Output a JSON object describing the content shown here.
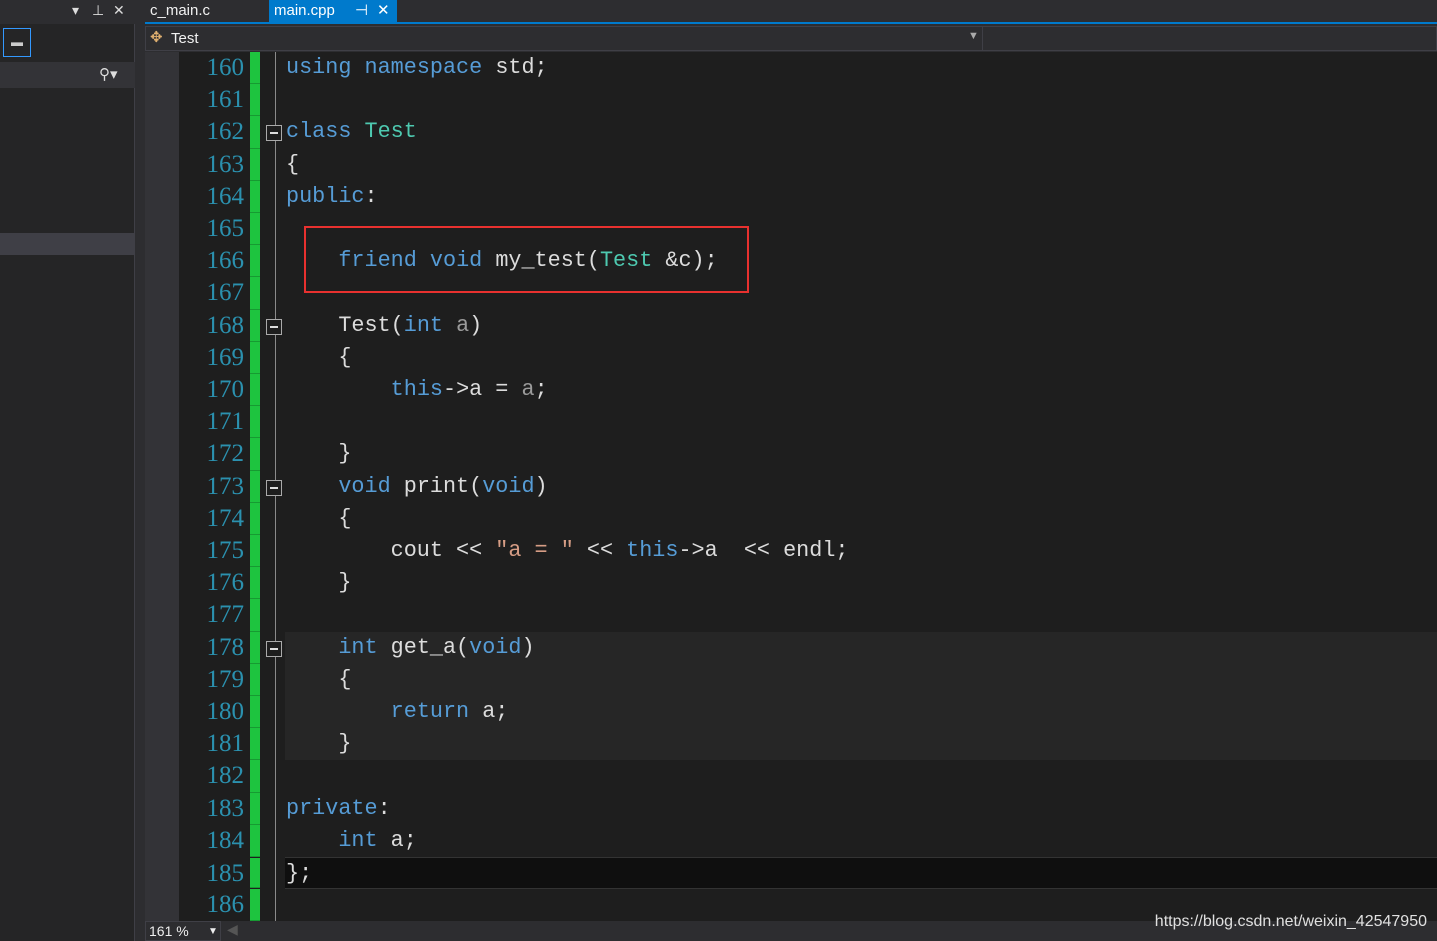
{
  "tabs": [
    {
      "label": "c_main.c",
      "active": false
    },
    {
      "label": "main.cpp",
      "active": true
    }
  ],
  "nav": {
    "scope": "Test"
  },
  "status": {
    "zoom": "161 %"
  },
  "watermark": "https://blog.csdn.net/weixin_42547950",
  "colors": {
    "keyword": "#569cd6",
    "type": "#4ec9b0",
    "text": "#dcdcdc",
    "param": "#9b9b9b",
    "string": "#d69d85",
    "linenum": "#2b91af",
    "accent": "#007acc",
    "highlight_box": "#e8312f"
  },
  "code": [
    {
      "n": "160",
      "t": [
        [
          "k",
          "using"
        ],
        [
          "p",
          " "
        ],
        [
          "k",
          "namespace"
        ],
        [
          "p",
          " std;"
        ]
      ]
    },
    {
      "n": "161",
      "t": []
    },
    {
      "n": "162",
      "fold": true,
      "t": [
        [
          "k",
          "class"
        ],
        [
          "p",
          " "
        ],
        [
          "y",
          "Test"
        ]
      ]
    },
    {
      "n": "163",
      "t": [
        [
          "p",
          "{"
        ]
      ]
    },
    {
      "n": "164",
      "t": [
        [
          "k",
          "public"
        ],
        [
          "p",
          ":"
        ]
      ]
    },
    {
      "n": "165",
      "t": []
    },
    {
      "n": "166",
      "t": [
        [
          "p",
          "    "
        ],
        [
          "k",
          "friend"
        ],
        [
          "p",
          " "
        ],
        [
          "k",
          "void"
        ],
        [
          "p",
          " my_test("
        ],
        [
          "y",
          "Test"
        ],
        [
          "p",
          " &c);"
        ]
      ]
    },
    {
      "n": "167",
      "t": []
    },
    {
      "n": "168",
      "fold": true,
      "t": [
        [
          "p",
          "    Test("
        ],
        [
          "k",
          "int"
        ],
        [
          "p",
          " "
        ],
        [
          "a",
          "a"
        ],
        [
          "p",
          ")"
        ]
      ]
    },
    {
      "n": "169",
      "t": [
        [
          "p",
          "    {"
        ]
      ]
    },
    {
      "n": "170",
      "t": [
        [
          "p",
          "        "
        ],
        [
          "k",
          "this"
        ],
        [
          "p",
          "->a = "
        ],
        [
          "a",
          "a"
        ],
        [
          "p",
          ";"
        ]
      ]
    },
    {
      "n": "171",
      "t": []
    },
    {
      "n": "172",
      "t": [
        [
          "p",
          "    }"
        ]
      ]
    },
    {
      "n": "173",
      "fold": true,
      "t": [
        [
          "p",
          "    "
        ],
        [
          "k",
          "void"
        ],
        [
          "p",
          " print("
        ],
        [
          "k",
          "void"
        ],
        [
          "p",
          ")"
        ]
      ]
    },
    {
      "n": "174",
      "t": [
        [
          "p",
          "    {"
        ]
      ]
    },
    {
      "n": "175",
      "t": [
        [
          "p",
          "        cout << "
        ],
        [
          "s",
          "\"a = \""
        ],
        [
          "p",
          " << "
        ],
        [
          "k",
          "this"
        ],
        [
          "p",
          "->a  << endl;"
        ]
      ]
    },
    {
      "n": "176",
      "t": [
        [
          "p",
          "    }"
        ]
      ]
    },
    {
      "n": "177",
      "t": []
    },
    {
      "n": "178",
      "fold": true,
      "t": [
        [
          "p",
          "    "
        ],
        [
          "k",
          "int"
        ],
        [
          "p",
          " get_a("
        ],
        [
          "k",
          "void"
        ],
        [
          "p",
          ")"
        ]
      ]
    },
    {
      "n": "179",
      "t": [
        [
          "p",
          "    {"
        ]
      ]
    },
    {
      "n": "180",
      "t": [
        [
          "p",
          "        "
        ],
        [
          "k",
          "return"
        ],
        [
          "p",
          " a;"
        ]
      ]
    },
    {
      "n": "181",
      "t": [
        [
          "p",
          "    }"
        ]
      ]
    },
    {
      "n": "182",
      "t": []
    },
    {
      "n": "183",
      "t": [
        [
          "k",
          "private"
        ],
        [
          "p",
          ":"
        ]
      ]
    },
    {
      "n": "184",
      "t": [
        [
          "p",
          "    "
        ],
        [
          "k",
          "int"
        ],
        [
          "p",
          " a;"
        ]
      ]
    },
    {
      "n": "185",
      "t": [
        [
          "p",
          "};"
        ]
      ]
    },
    {
      "n": "186",
      "t": []
    }
  ]
}
